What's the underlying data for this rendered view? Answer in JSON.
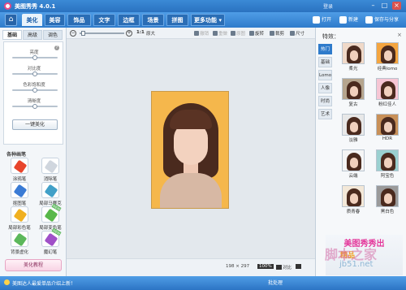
{
  "titlebar": {
    "title": "美图秀秀 4.0.1",
    "login": "登录",
    "min": "–",
    "max": "□",
    "close": "×"
  },
  "nav": {
    "tabs": [
      "美化",
      "美容",
      "饰品",
      "文字",
      "边框",
      "场景",
      "拼图"
    ],
    "more": "更多功能",
    "open": "打开",
    "new": "新建",
    "save": "保存与分享"
  },
  "left": {
    "subtabs": [
      "基础",
      "高级",
      "调色"
    ],
    "sliders": [
      {
        "label": "亮度",
        "value": 0.5
      },
      {
        "label": "对比度",
        "value": 0.5
      },
      {
        "label": "色彩饱和度",
        "value": 0.5
      },
      {
        "label": "清晰度",
        "value": 0.5
      }
    ],
    "onekey": "一键美化",
    "brush_title": "各种画笔",
    "brushes": [
      {
        "label": "涂鸦笔",
        "color": "#e8452c",
        "new": false
      },
      {
        "label": "消除笔",
        "color": "#d0d6de",
        "new": false
      },
      {
        "label": "抠图笔",
        "color": "#3a7bd5",
        "new": false
      },
      {
        "label": "局部马赛克",
        "color": "#41a0c8",
        "new": false
      },
      {
        "label": "局部彩色笔",
        "color": "#f0b020",
        "new": false
      },
      {
        "label": "局部变色笔",
        "color": "#58b84a",
        "new": true
      },
      {
        "label": "背景虚化",
        "color": "#5cb85c",
        "new": false
      },
      {
        "label": "魔幻笔",
        "color": "#a050c8",
        "new": true
      }
    ],
    "new_tag": "NEW",
    "beauty_btn": "美化教程"
  },
  "toolbar": {
    "zoom_reset": "1:1",
    "zoom_fit": "原大",
    "undo": "撤销",
    "redo": "重做",
    "original": "原图",
    "rotate": "旋转",
    "crop": "裁剪",
    "resize": "尺寸"
  },
  "status": {
    "size": "198 × 297",
    "zoom": "100%",
    "compare": "对比",
    "zoom_label": "",
    "batch": "批处理"
  },
  "right": {
    "title": "特效：",
    "close": "×",
    "categories": [
      "热门",
      "基础",
      "Lomo",
      "人像",
      "时尚",
      "艺术"
    ],
    "effects": [
      {
        "label": "柔光",
        "bg": "#f0d9c8"
      },
      {
        "label": "经典lomo",
        "bg": "#f4a540"
      },
      {
        "label": "复古",
        "bg": "#b5a58e"
      },
      {
        "label": "粉红佳人",
        "bg": "#f6c6d4"
      },
      {
        "label": "淡雅",
        "bg": "#e8e8e8"
      },
      {
        "label": "HDR",
        "bg": "#c89058"
      },
      {
        "label": "云端",
        "bg": "#f5f5f5"
      },
      {
        "label": "阿宝色",
        "bg": "#9ad0d0"
      },
      {
        "label": "质青春",
        "bg": "#f3e8d8"
      },
      {
        "label": "黑白色",
        "bg": "#9a9a9a"
      }
    ],
    "ad": "美图秀秀出",
    "ad_sub": "精品"
  },
  "bottom": {
    "message": "美图达人最爱单品介绍上新！"
  },
  "watermark": {
    "main": "脚本之家",
    "sub": "jb51.net"
  }
}
